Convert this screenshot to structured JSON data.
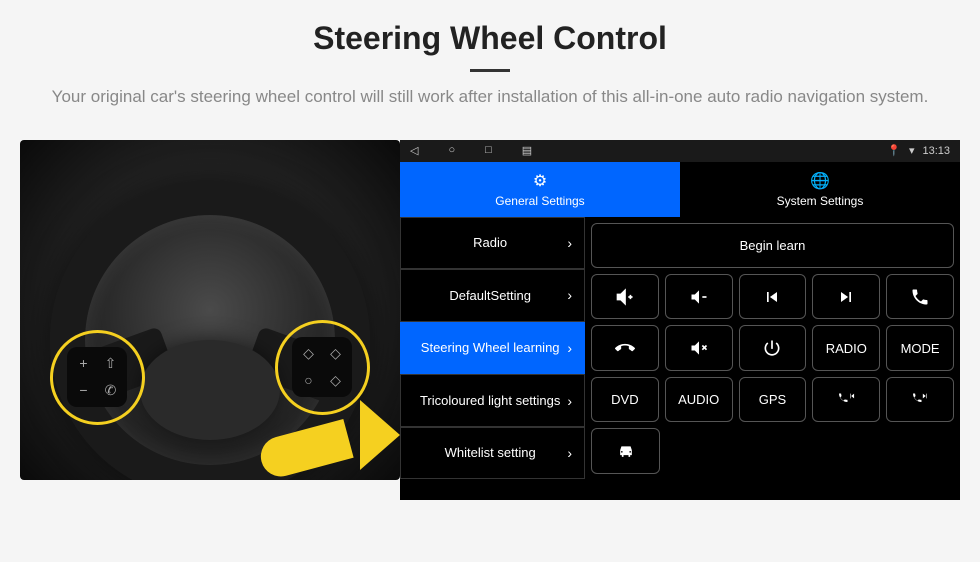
{
  "header": {
    "title": "Steering Wheel Control",
    "subtitle": "Your original car's steering wheel control will still work after installation of this all-in-one auto radio navigation system."
  },
  "statusbar": {
    "time": "13:13"
  },
  "tabs": {
    "general": "General Settings",
    "system": "System Settings"
  },
  "sidebar": {
    "items": [
      {
        "label": "Radio"
      },
      {
        "label": "DefaultSetting"
      },
      {
        "label": "Steering Wheel learning"
      },
      {
        "label": "Tricoloured light settings"
      },
      {
        "label": "Whitelist setting"
      }
    ]
  },
  "buttons": {
    "begin_learn": "Begin learn",
    "radio": "RADIO",
    "mode": "MODE",
    "dvd": "DVD",
    "audio": "AUDIO",
    "gps": "GPS"
  },
  "wheel_pad": {
    "plus": "+",
    "minus": "−",
    "voice": "⇧",
    "phone": "✆",
    "up": "◇",
    "down": "◇",
    "cycle": "○",
    "menu": "◇"
  }
}
